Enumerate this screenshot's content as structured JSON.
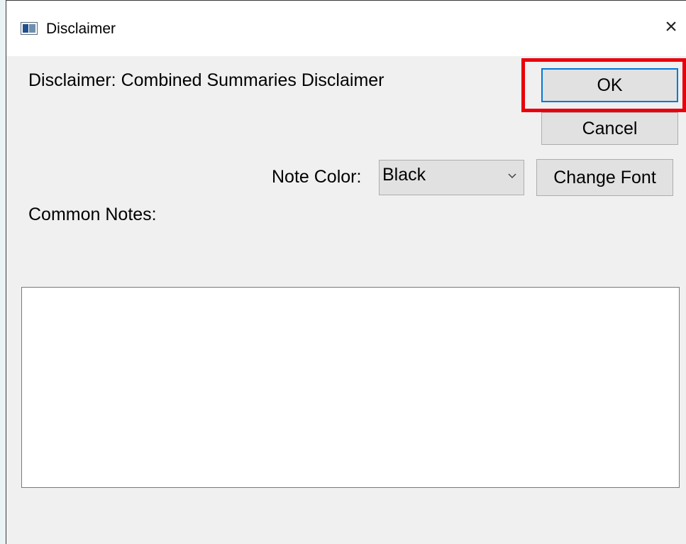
{
  "window": {
    "title": "Disclaimer",
    "close_glyph": "×"
  },
  "content": {
    "disclaimer_label": "Disclaimer: Combined Summaries Disclaimer",
    "note_color_label": "Note Color:",
    "note_color_value": "Black",
    "common_notes_label": "Common Notes:",
    "common_notes_value": ""
  },
  "buttons": {
    "ok": "OK",
    "cancel": "Cancel",
    "change_font": "Change Font"
  },
  "colors": {
    "highlight": "#e8000b",
    "focus_border": "#0078d7"
  }
}
